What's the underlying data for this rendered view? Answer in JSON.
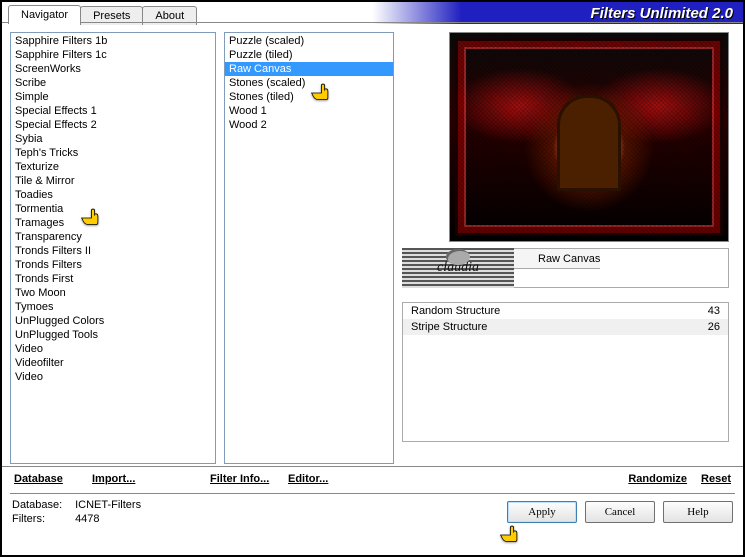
{
  "title": "Filters Unlimited 2.0",
  "tabs": {
    "t0": "Navigator",
    "t1": "Presets",
    "t2": "About"
  },
  "left_list": [
    "Sapphire Filters 1b",
    "Sapphire Filters 1c",
    "ScreenWorks",
    "Scribe",
    "Simple",
    "Special Effects 1",
    "Special Effects 2",
    "Sybia",
    "Teph's Tricks",
    "Texturize",
    "Tile & Mirror",
    "Toadies",
    "Tormentia",
    "Tramages",
    "Transparency",
    "Tronds Filters II",
    "Tronds Filters",
    "Tronds First",
    "Two Moon",
    "Tymoes",
    "UnPlugged Colors",
    "UnPlugged Tools",
    "Video",
    "Videofilter",
    "Video"
  ],
  "left_highlight_index": 9,
  "mid_list": [
    "Puzzle (scaled)",
    "Puzzle (tiled)",
    "Raw Canvas",
    "Stones (scaled)",
    "Stones (tiled)",
    "Wood 1",
    "Wood 2"
  ],
  "mid_selected_index": 2,
  "logo_text": "claudia",
  "filter_name": "Raw Canvas",
  "params": [
    {
      "label": "Random Structure",
      "value": "43"
    },
    {
      "label": "Stripe Structure",
      "value": "26"
    }
  ],
  "bottom_links": {
    "database": "Database",
    "import": "Import...",
    "filterinfo": "Filter Info...",
    "editor": "Editor...",
    "randomize": "Randomize",
    "reset": "Reset"
  },
  "footer": {
    "db_label": "Database:",
    "db_val": "ICNET-Filters",
    "filters_label": "Filters:",
    "filters_val": "4478",
    "apply": "Apply",
    "cancel": "Cancel",
    "help": "Help"
  }
}
